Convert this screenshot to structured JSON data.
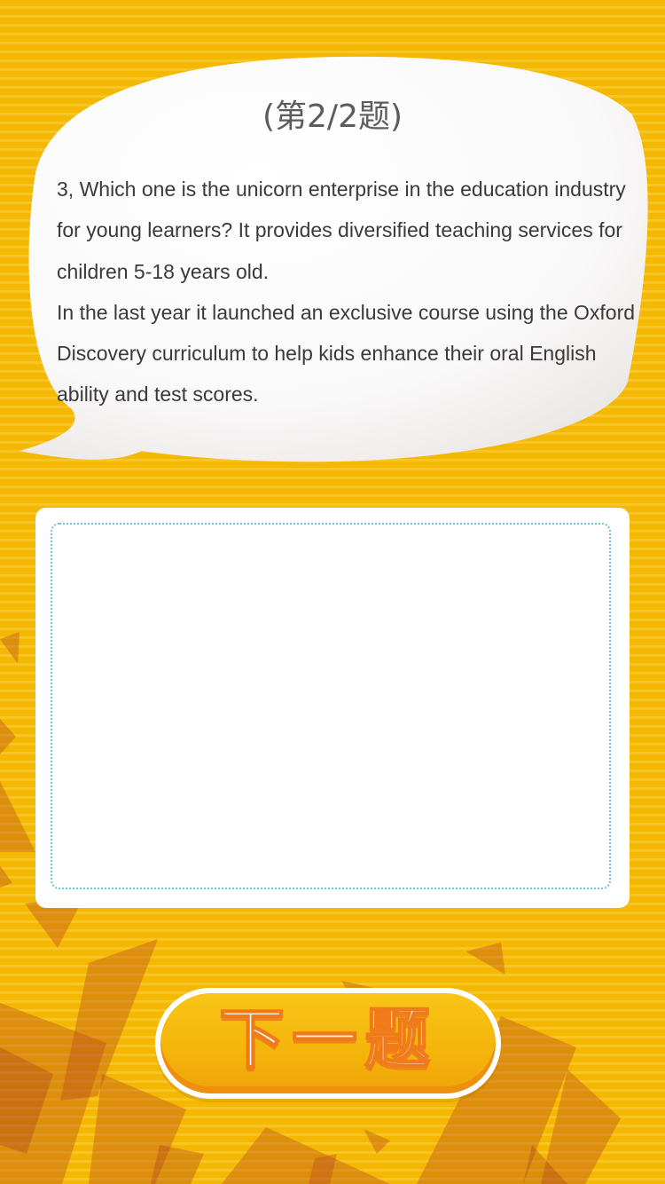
{
  "question": {
    "counter": "(第2/2题)",
    "paragraphs": [
      "3, Which one is the unicorn enterprise in the education industry for young learners? It provides diversified teaching services for children 5-18 years old.",
      "In the last year it launched an exclusive course using the Oxford Discovery curriculum to help kids enhance their oral English ability and test scores."
    ]
  },
  "answer": {
    "value": "",
    "placeholder": ""
  },
  "next_button": {
    "label": "下一题"
  },
  "colors": {
    "background": "#f4b800",
    "stripe": "#f7c42a",
    "answer_border": "#6fc0dc",
    "button_fill": "#f5b60b",
    "button_outline": "#f07b1a"
  }
}
